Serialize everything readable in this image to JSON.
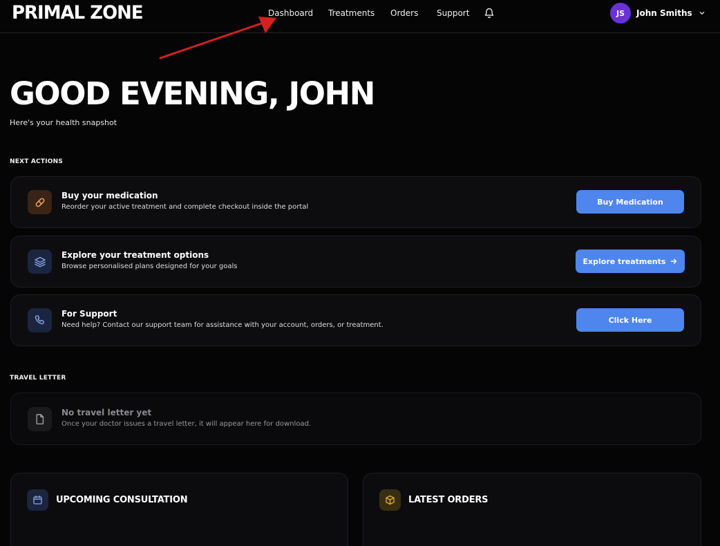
{
  "brand": {
    "logo": "PRIMAL ZONE"
  },
  "nav": {
    "items": [
      {
        "label": "Dashboard"
      },
      {
        "label": "Treatments"
      },
      {
        "label": "Orders"
      },
      {
        "label": "Support"
      }
    ],
    "notification_icon": "bell-icon"
  },
  "user": {
    "initials": "JS",
    "name": "John Smiths",
    "avatar_color": "#6b31d8"
  },
  "hero": {
    "title": "GOOD EVENING, JOHN",
    "subtitle": "Here's your health snapshot"
  },
  "next_actions": {
    "label": "NEXT ACTIONS",
    "items": [
      {
        "icon": "pill-icon",
        "title": "Buy your medication",
        "description": "Reorder your active treatment and complete checkout inside the portal",
        "button": "Buy Medication"
      },
      {
        "icon": "layers-icon",
        "title": "Explore your treatment options",
        "description": "Browse personalised plans designed for your goals",
        "button": "Explore treatments",
        "button_icon": "arrow-right-icon"
      },
      {
        "icon": "phone-icon",
        "title": "For Support",
        "description": "Need help? Contact our support team for assistance with your account, orders, or treatment.",
        "button": "Click Here"
      }
    ]
  },
  "travel_letter": {
    "label": "TRAVEL LETTER",
    "icon": "document-icon",
    "title": "No travel letter yet",
    "description": "Once your doctor issues a travel letter, it will appear here for download."
  },
  "panels": {
    "consultation": {
      "icon": "calendar-icon",
      "title": "UPCOMING CONSULTATION"
    },
    "orders": {
      "icon": "package-icon",
      "title": "LATEST ORDERS"
    }
  },
  "colors": {
    "accent": "#4e86ee",
    "background": "#050505",
    "annotation_arrow": "#d42020"
  }
}
